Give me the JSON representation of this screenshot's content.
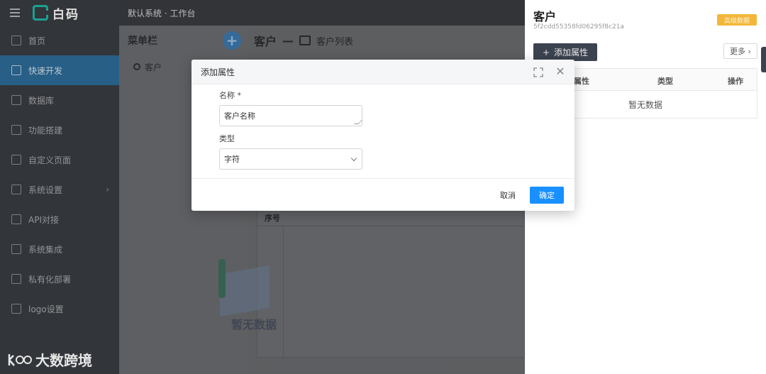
{
  "app": {
    "brand": "白码",
    "breadcrumb": "默认系统 · 工作台"
  },
  "sidebar": {
    "items": [
      {
        "label": "首页",
        "icon": "home-icon"
      },
      {
        "label": "快速开发",
        "icon": "cube-icon",
        "active": true
      },
      {
        "label": "数据库",
        "icon": "database-icon"
      },
      {
        "label": "功能搭建",
        "icon": "build-icon"
      },
      {
        "label": "自定义页面",
        "icon": "page-icon"
      },
      {
        "label": "系统设置",
        "icon": "monitor-icon",
        "chevron": true
      },
      {
        "label": "API对接",
        "icon": "api-icon"
      },
      {
        "label": "系统集成",
        "icon": "layers-icon"
      },
      {
        "label": "私有化部署",
        "icon": "deploy-icon"
      },
      {
        "label": "logo设置",
        "icon": "logo-icon"
      }
    ]
  },
  "menu_panel": {
    "title": "菜单栏",
    "items": [
      {
        "label": "客户"
      }
    ]
  },
  "main": {
    "title": "客户",
    "dash": "—",
    "subtitle": "客户列表",
    "table_header": "序号",
    "empty_text": "暂无数据"
  },
  "drawer": {
    "title": "客户",
    "id": "5f2cdd55358fd06295f8c21a",
    "badge": "高级数据",
    "add_button": "添加属性",
    "more_button": "更多",
    "table": {
      "columns": [
        "属性",
        "类型",
        "操作"
      ],
      "empty_text": "暂无数据"
    }
  },
  "modal": {
    "title": "添加属性",
    "name_label": "名称 *",
    "name_value": "客户名称",
    "type_label": "类型",
    "type_value": "字符",
    "cancel": "取消",
    "confirm": "确定"
  },
  "watermark": {
    "text": "大数跨境"
  },
  "colors": {
    "sidebar_bg": "#3a3d41",
    "active_item": "#2d6d9a",
    "primary": "#1890ff",
    "badge": "#f2b73a",
    "drawer_button": "#3c4350"
  }
}
